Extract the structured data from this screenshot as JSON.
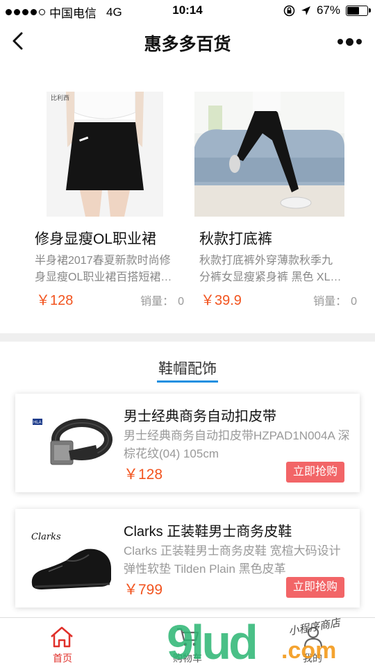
{
  "status": {
    "carrier": "中国电信",
    "network": "4G",
    "time": "10:14",
    "battery": "67%",
    "battery_level": 0.67
  },
  "nav": {
    "title": "惠多多百货"
  },
  "products": [
    {
      "name": "修身显瘦OL职业裙",
      "desc": "半身裙2017春夏新款时尚修身显瘦OL职业裙百搭短裙…",
      "price": "￥128",
      "sales_label": "销量：",
      "sales": "0",
      "brand_text": "比利西"
    },
    {
      "name": "秋款打底裤",
      "desc": "秋款打底裤外穿薄款秋季九分裤女显瘦紧身裤 黑色 XL…",
      "price": "￥39.9",
      "sales_label": "销量：",
      "sales": "0"
    }
  ],
  "section": {
    "title": "鞋帽配饰"
  },
  "items": [
    {
      "name": "男士经典商务自动扣皮带",
      "desc": "男士经典商务自动扣皮带HZPAD1N004A 深棕花纹(04) 105cm",
      "price": "￥128",
      "buy": "立即抢购",
      "brand": "HLA"
    },
    {
      "name": "Clarks 正装鞋男士商务皮鞋",
      "desc": "Clarks 正装鞋男士商务皮鞋 宽楦大码设计 弹性软垫 Tilden Plain 黑色皮革",
      "price": "￥799",
      "buy": "立即抢购",
      "brand": "Clarks"
    }
  ],
  "tabbar": {
    "tabs": [
      {
        "label": "首页",
        "icon": "home-icon"
      },
      {
        "label": "购物车",
        "icon": "cart-icon"
      },
      {
        "label": "我的",
        "icon": "user-icon"
      }
    ]
  },
  "watermark": {
    "main": "9lud",
    "dotcom": ".com",
    "tagline": "小程序商店"
  },
  "colors": {
    "price": "#f2541f",
    "buy": "#f26567",
    "accent": "#1a8fe0",
    "active_tab": "#e0302a"
  }
}
